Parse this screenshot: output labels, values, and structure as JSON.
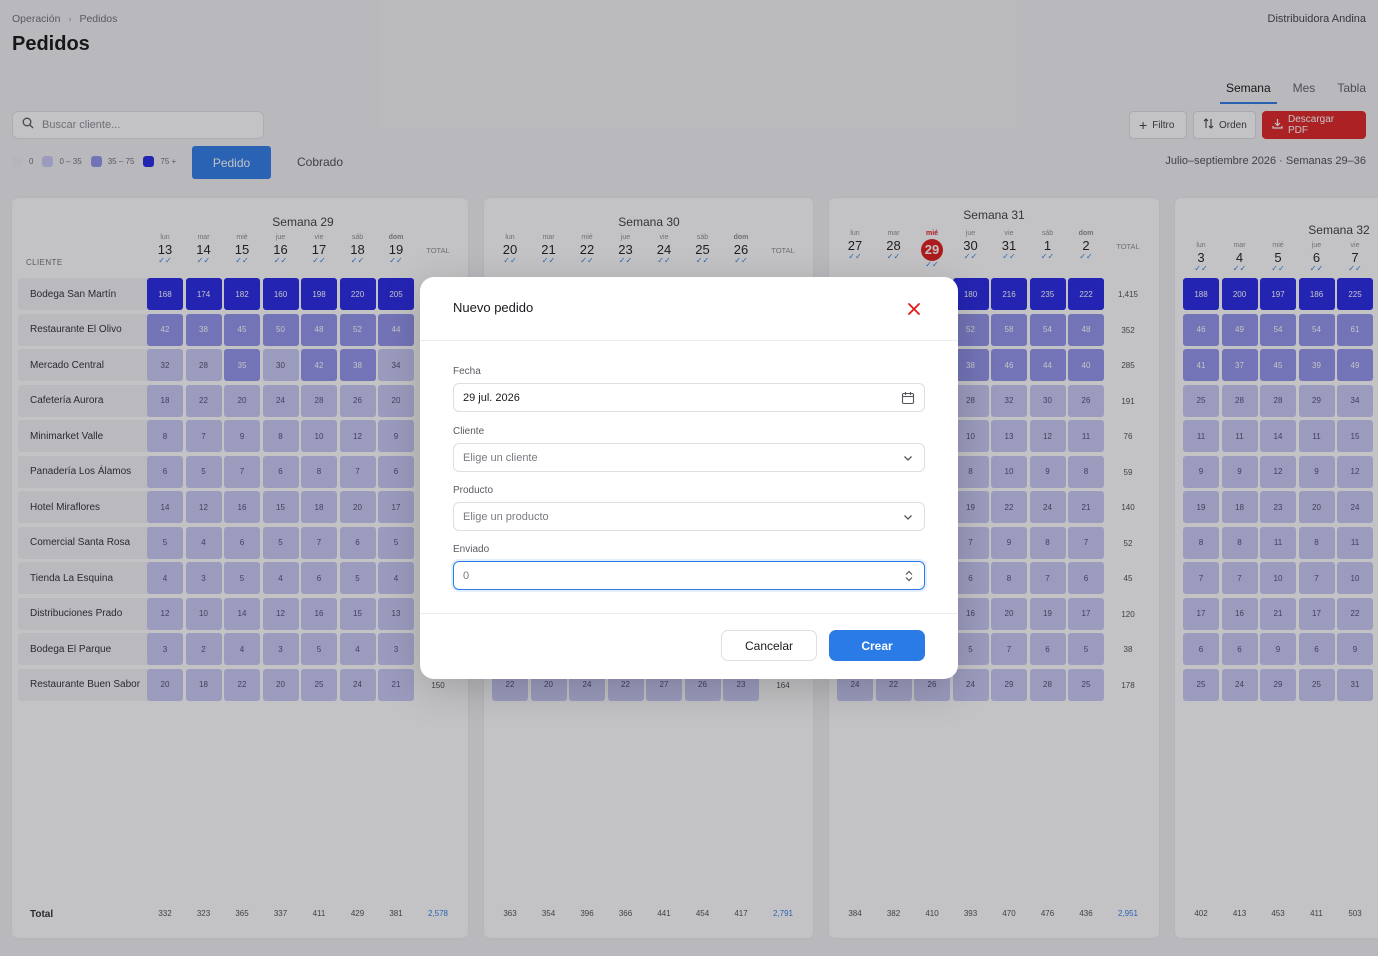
{
  "breadcrumb": {
    "parent": "Operación",
    "sep": "›",
    "current": "Pedidos"
  },
  "company": "Distribuidora Andina",
  "page_title": "Pedidos",
  "views": [
    {
      "label": "Semana",
      "active": true
    },
    {
      "label": "Mes",
      "active": false
    },
    {
      "label": "Tabla",
      "active": false
    }
  ],
  "search": {
    "placeholder": "Buscar cliente...",
    "icon": "search-icon"
  },
  "toolbar": {
    "filter_label": "Filtro",
    "order_label": "Orden",
    "pdf_label": "Descargar PDF"
  },
  "legend": [
    {
      "label": "0",
      "color": "#ececf0"
    },
    {
      "label": "0 – 35",
      "color": "#c8c8f6"
    },
    {
      "label": "35 – 75",
      "color": "#9090ec"
    },
    {
      "label": "75 +",
      "color": "#2323e6"
    }
  ],
  "mode": {
    "active": "Pedido",
    "other": "Cobrado"
  },
  "period": "Julio–septiembre 2026 · Semanas 29–36",
  "grid": {
    "client_header": "CLIENTE",
    "total_header": "TOTAL",
    "total_row_label": "Total",
    "clients": [
      "Bodega San Martín",
      "Restaurante El Olivo",
      "Mercado Central",
      "Cafetería Aurora",
      "Minimarket Valle",
      "Panadería Los Álamos",
      "Hotel Miraflores",
      "Comercial Santa Rosa",
      "Tienda La Esquina",
      "Distribuciones Prado",
      "Bodega El Parque",
      "Restaurante Buen Sabor"
    ]
  },
  "weeks": [
    {
      "name": "Semana 29",
      "days": [
        {
          "dow": "lun",
          "num": "13"
        },
        {
          "dow": "mar",
          "num": "14"
        },
        {
          "dow": "mié",
          "num": "15"
        },
        {
          "dow": "jue",
          "num": "16"
        },
        {
          "dow": "vie",
          "num": "17"
        },
        {
          "dow": "sáb",
          "num": "18"
        },
        {
          "dow": "dom",
          "num": "19"
        }
      ],
      "rows": [
        [
          "168",
          "174",
          "182",
          "160",
          "198",
          "220",
          "205"
        ],
        [
          "42",
          "38",
          "45",
          "50",
          "48",
          "52",
          "44"
        ],
        [
          "32",
          "28",
          "35",
          "30",
          "42",
          "38",
          "34"
        ],
        [
          "18",
          "22",
          "20",
          "24",
          "28",
          "26",
          "20"
        ],
        [
          "8",
          "7",
          "9",
          "8",
          "10",
          "12",
          "9"
        ],
        [
          "6",
          "5",
          "7",
          "6",
          "8",
          "7",
          "6"
        ],
        [
          "14",
          "12",
          "16",
          "15",
          "18",
          "20",
          "17"
        ],
        [
          "5",
          "4",
          "6",
          "5",
          "7",
          "6",
          "5"
        ],
        [
          "4",
          "3",
          "5",
          "4",
          "6",
          "5",
          "4"
        ],
        [
          "12",
          "10",
          "14",
          "12",
          "16",
          "15",
          "13"
        ],
        [
          "3",
          "2",
          "4",
          "3",
          "5",
          "4",
          "3"
        ],
        [
          "20",
          "18",
          "22",
          "20",
          "25",
          "24",
          "21"
        ]
      ],
      "row_totals": [
        "",
        "",
        "",
        "",
        "",
        "",
        "",
        "",
        "",
        "",
        "",
        "150"
      ],
      "day_totals": [
        "332",
        "323",
        "365",
        "337",
        "411",
        "429",
        "381"
      ],
      "week_total": "2,578"
    },
    {
      "name": "Semana 30",
      "days": [
        {
          "dow": "lun",
          "num": "20"
        },
        {
          "dow": "mar",
          "num": "21"
        },
        {
          "dow": "mié",
          "num": "22"
        },
        {
          "dow": "jue",
          "num": "23"
        },
        {
          "dow": "vie",
          "num": "24"
        },
        {
          "dow": "sáb",
          "num": "25"
        },
        {
          "dow": "dom",
          "num": "26"
        }
      ],
      "rows": [
        [],
        [],
        [],
        [],
        [],
        [],
        [],
        [],
        [],
        [],
        [],
        [
          "22",
          "20",
          "24",
          "22",
          "27",
          "26",
          "23"
        ]
      ],
      "row_totals": [
        "",
        "",
        "",
        "",
        "",
        "",
        "",
        "",
        "",
        "",
        "",
        "164"
      ],
      "day_totals": [
        "363",
        "354",
        "396",
        "366",
        "441",
        "454",
        "417"
      ],
      "week_total": "2,791"
    },
    {
      "name": "Semana 31",
      "days": [
        {
          "dow": "lun",
          "num": "27"
        },
        {
          "dow": "mar",
          "num": "28"
        },
        {
          "dow": "mié",
          "num": "29",
          "today": true
        },
        {
          "dow": "jue",
          "num": "30"
        },
        {
          "dow": "vie",
          "num": "31"
        },
        {
          "dow": "sáb",
          "num": "1"
        },
        {
          "dow": "dom",
          "num": "2"
        }
      ],
      "rows": [
        [
          "",
          "",
          "",
          "180",
          "216",
          "235",
          "222"
        ],
        [
          "",
          "",
          "",
          "52",
          "58",
          "54",
          "48"
        ],
        [
          "",
          "",
          "",
          "38",
          "46",
          "44",
          "40"
        ],
        [
          "",
          "",
          "",
          "28",
          "32",
          "30",
          "26"
        ],
        [
          "",
          "",
          "",
          "10",
          "13",
          "12",
          "11"
        ],
        [
          "",
          "",
          "",
          "8",
          "10",
          "9",
          "8"
        ],
        [
          "",
          "",
          "",
          "19",
          "22",
          "24",
          "21"
        ],
        [
          "",
          "",
          "",
          "7",
          "9",
          "8",
          "7"
        ],
        [
          "",
          "",
          "",
          "6",
          "8",
          "7",
          "6"
        ],
        [
          "",
          "",
          "",
          "16",
          "20",
          "19",
          "17"
        ],
        [
          "",
          "",
          "",
          "5",
          "7",
          "6",
          "5"
        ],
        [
          "24",
          "22",
          "26",
          "24",
          "29",
          "28",
          "25"
        ]
      ],
      "row_totals": [
        "1,415",
        "352",
        "285",
        "191",
        "76",
        "59",
        "140",
        "52",
        "45",
        "120",
        "38",
        "178"
      ],
      "day_totals": [
        "384",
        "382",
        "410",
        "393",
        "470",
        "476",
        "436"
      ],
      "week_total": "2,951"
    },
    {
      "name": "Semana 32",
      "days": [
        {
          "dow": "lun",
          "num": "3"
        },
        {
          "dow": "mar",
          "num": "4"
        },
        {
          "dow": "mié",
          "num": "5"
        },
        {
          "dow": "jue",
          "num": "6"
        },
        {
          "dow": "vie",
          "num": "7"
        }
      ],
      "rows": [
        [
          "188",
          "200",
          "197",
          "186",
          "225"
        ],
        [
          "46",
          "49",
          "54",
          "54",
          "61"
        ],
        [
          "41",
          "37",
          "45",
          "39",
          "49"
        ],
        [
          "25",
          "28",
          "28",
          "29",
          "34"
        ],
        [
          "11",
          "11",
          "14",
          "11",
          "15"
        ],
        [
          "9",
          "9",
          "12",
          "9",
          "12"
        ],
        [
          "19",
          "18",
          "23",
          "20",
          "24"
        ],
        [
          "8",
          "8",
          "11",
          "8",
          "11"
        ],
        [
          "7",
          "7",
          "10",
          "7",
          "10"
        ],
        [
          "17",
          "16",
          "21",
          "17",
          "22"
        ],
        [
          "6",
          "6",
          "9",
          "6",
          "9"
        ],
        [
          "25",
          "24",
          "29",
          "25",
          "31"
        ]
      ],
      "row_totals": [],
      "day_totals": [
        "402",
        "413",
        "453",
        "411",
        "503"
      ],
      "week_total": ""
    }
  ],
  "modal": {
    "title": "Nuevo pedido",
    "close_icon": "close-icon",
    "fecha_label": "Fecha",
    "fecha_value": "29 jul. 2026",
    "cliente_label": "Cliente",
    "cliente_placeholder": "Elige un cliente",
    "producto_label": "Producto",
    "producto_placeholder": "Elige un producto",
    "enviado_label": "Enviado",
    "enviado_value": "0",
    "cancel_label": "Cancelar",
    "create_label": "Crear"
  }
}
